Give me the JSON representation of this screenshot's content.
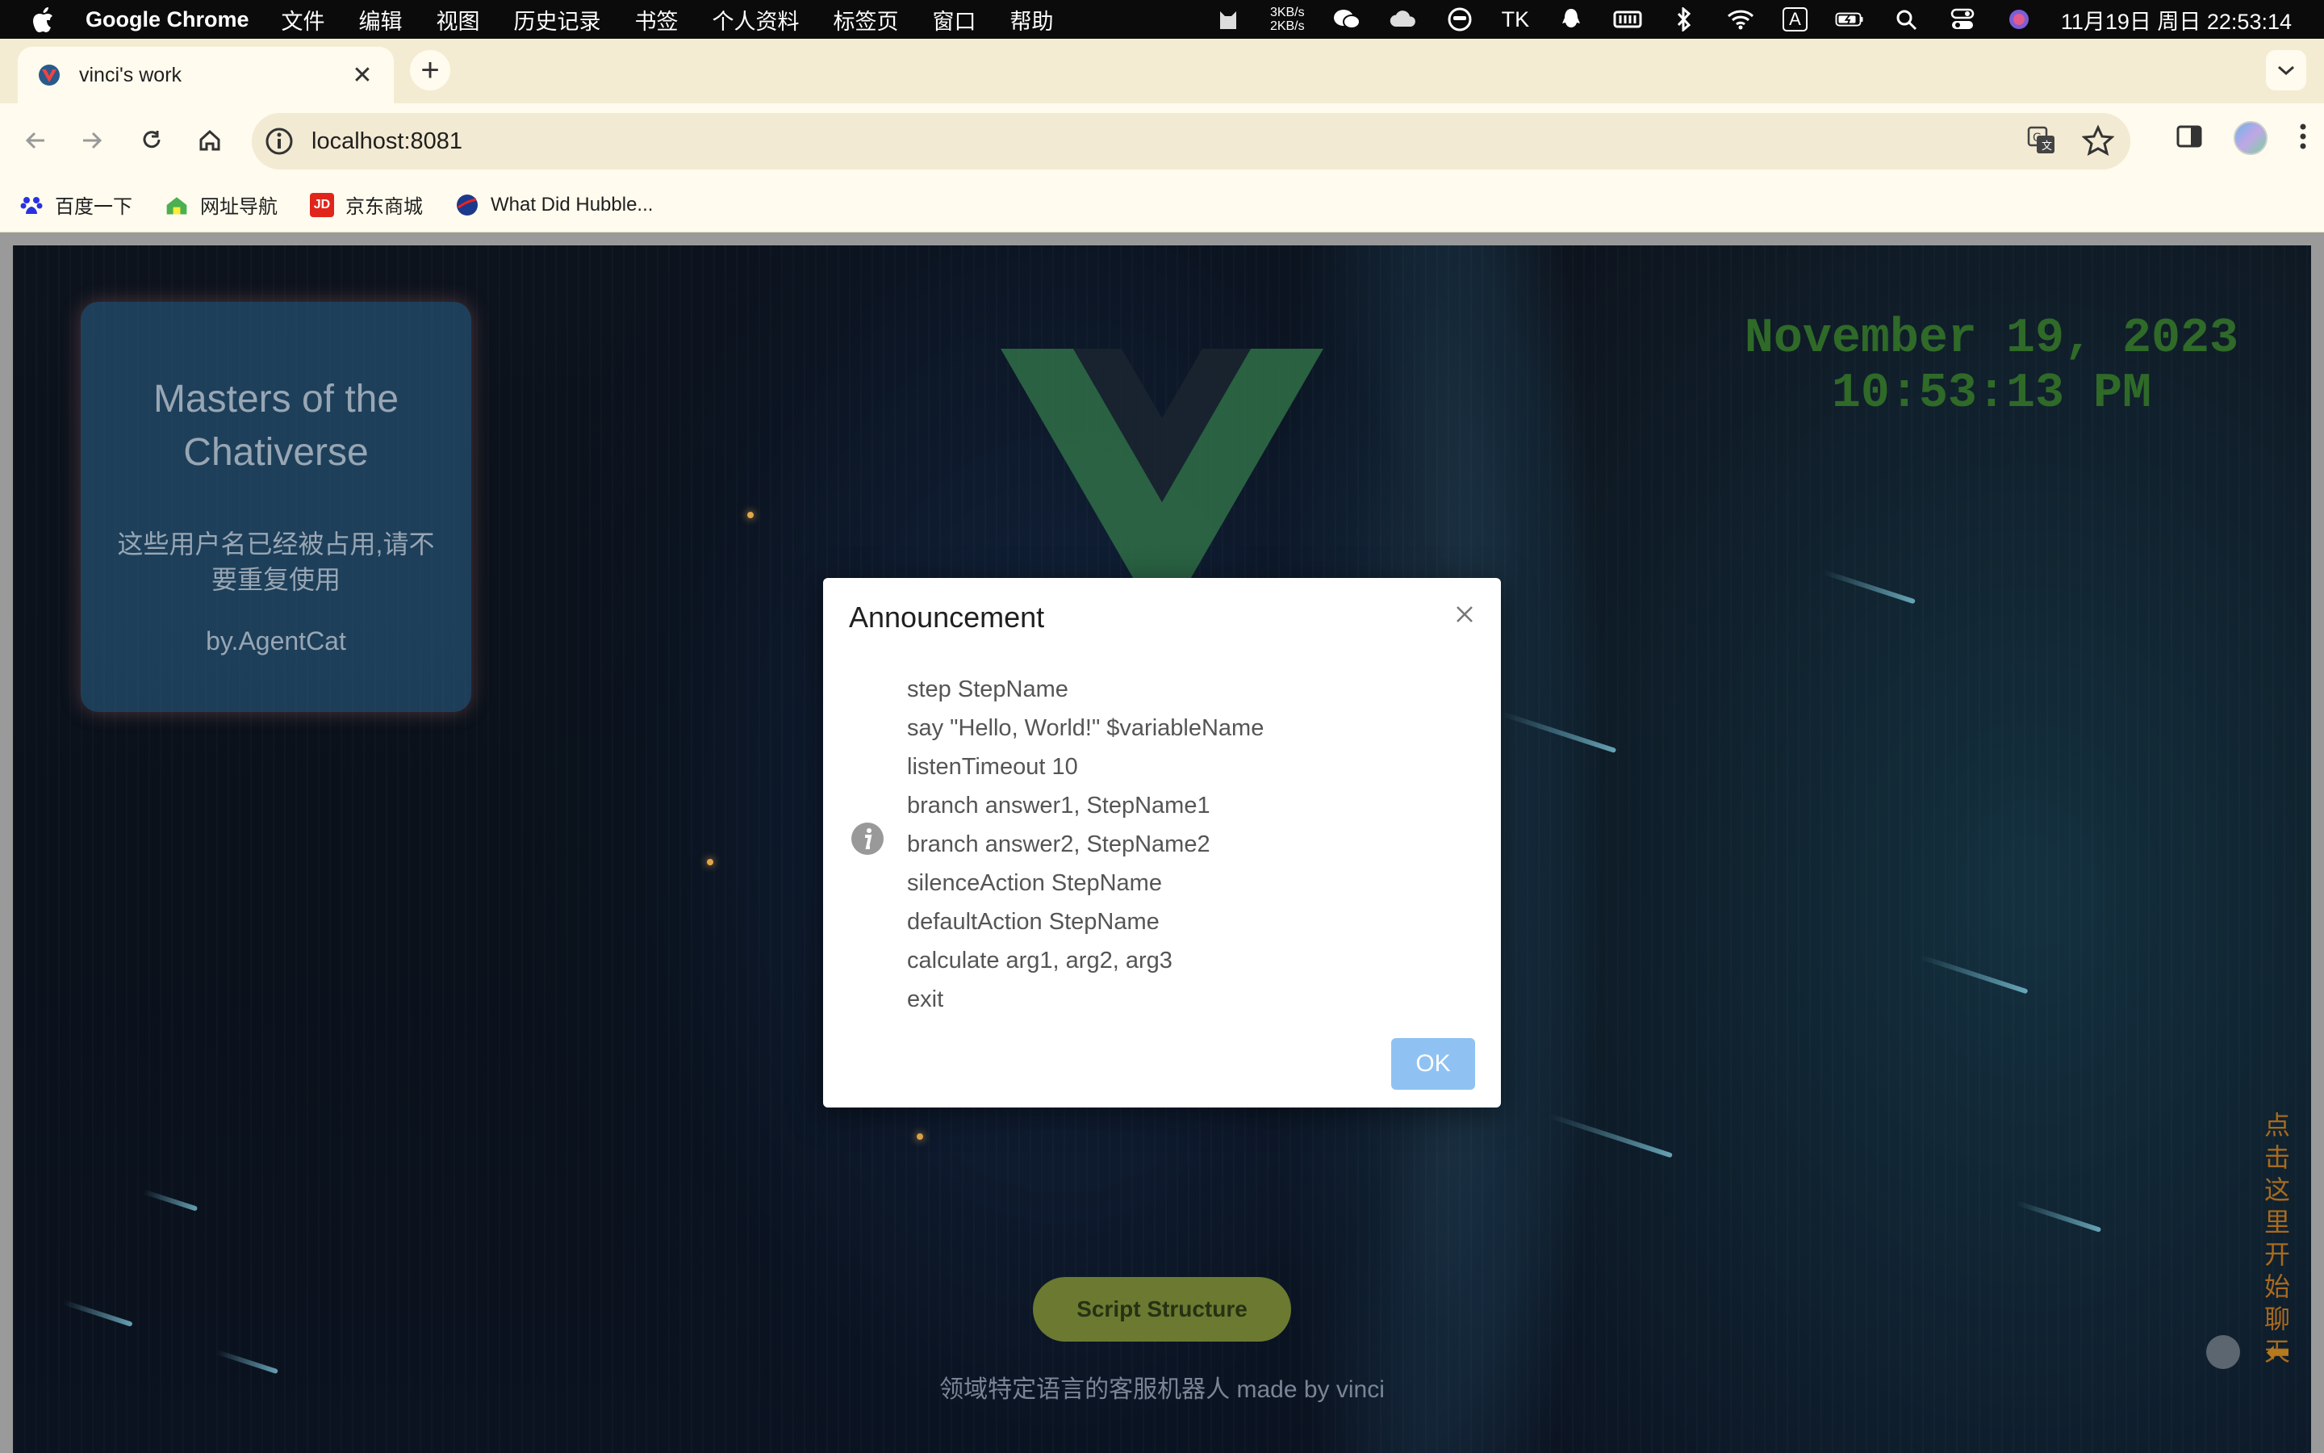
{
  "menubar": {
    "app_name": "Google Chrome",
    "items": [
      "文件",
      "编辑",
      "视图",
      "历史记录",
      "书签",
      "个人资料",
      "标签页",
      "窗口",
      "帮助"
    ],
    "net_up": "3KB/s",
    "net_down": "2KB/s",
    "tk": "TK",
    "ime": "A",
    "clock": "11月19日 周日  22:53:14"
  },
  "browser": {
    "tab_title": "vinci's work",
    "url": "localhost:8081",
    "bookmarks": [
      {
        "label": "百度一下",
        "icon": "baidu-icon",
        "color": "#2932e1"
      },
      {
        "label": "网址导航",
        "icon": "house-icon",
        "color": "#4caf50"
      },
      {
        "label": "京东商城",
        "icon": "jd-icon",
        "color": "#e1251b",
        "badge": "JD"
      },
      {
        "label": "What Did Hubble...",
        "icon": "nasa-icon",
        "color": "#1c3a8c"
      }
    ]
  },
  "page": {
    "card_title": "Masters of the Chativerse",
    "card_subtitle": "这些用户名已经被占用,请不要重复使用",
    "card_by": "by.AgentCat",
    "date": "November 19, 2023",
    "time": "10:53:13 PM",
    "script_button": "Script Structure",
    "footer": "领域特定语言的客服机器人 made by vinci",
    "side_text": "点击这里开始聊天",
    "colors": {
      "datetime": "#2f6a28",
      "button": "#6b7a30",
      "side_text": "#a86a1e"
    }
  },
  "modal": {
    "title": "Announcement",
    "lines": [
      "step StepName",
      "say \"Hello, World!\" $variableName",
      "listenTimeout 10",
      "branch answer1, StepName1",
      "branch answer2, StepName2",
      "silenceAction StepName",
      "defaultAction StepName",
      "calculate arg1, arg2, arg3",
      "exit"
    ],
    "ok_label": "OK"
  }
}
